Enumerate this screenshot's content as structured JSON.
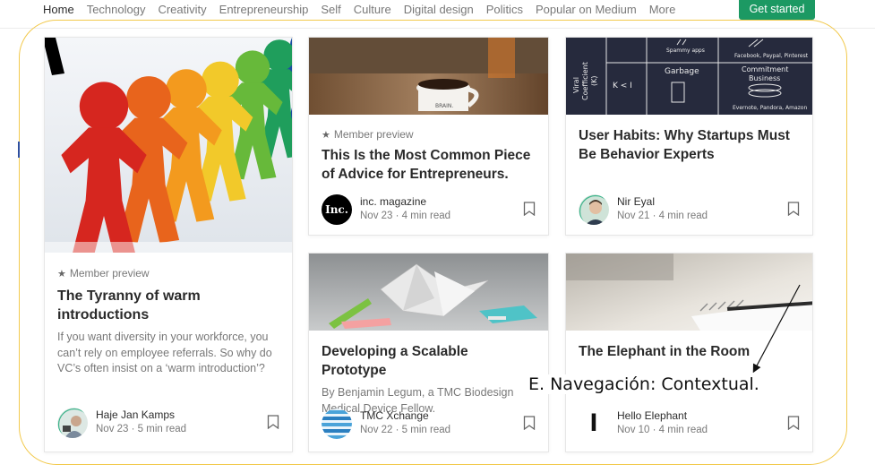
{
  "nav": {
    "items": [
      {
        "label": "Home",
        "active": true
      },
      {
        "label": "Technology"
      },
      {
        "label": "Creativity"
      },
      {
        "label": "Entrepreneurship"
      },
      {
        "label": "Self"
      },
      {
        "label": "Culture"
      },
      {
        "label": "Digital design"
      },
      {
        "label": "Politics"
      },
      {
        "label": "Popular on Medium"
      },
      {
        "label": "More"
      }
    ],
    "cta_label": "Get started",
    "cta_color": "#1c9963"
  },
  "cards": [
    {
      "member_preview": "Member preview",
      "title": "The Tyranny of warm introductions",
      "snippet": "If you want diversity in your workforce, you can’t rely on employee referrals. So why do VC’s often insist on a ‘warm introduction’?",
      "author": "Haje Jan Kamps",
      "date": "Nov 23",
      "read_time": "5 min read"
    },
    {
      "member_preview": "Member preview",
      "title": "This Is the Most Common Piece of Advice for Entrepreneurs.",
      "author": "inc. magazine",
      "date": "Nov 23",
      "read_time": "4 min read",
      "avatar_text": "Inc.",
      "mug_text": "BRAIN."
    },
    {
      "title": "User Habits: Why Startups Must Be Behavior Experts",
      "author": "Nir Eyal",
      "date": "Nov 21",
      "read_time": "4 min read",
      "chalk": {
        "viral": "Viral",
        "coefficient": "Coefficient",
        "k": "(K)",
        "k_less": "K < I",
        "spammy": "Spammy apps",
        "garbage": "Garbage",
        "social": "Facebook, Paypal, Pinterest",
        "commitment": "Commitment",
        "business": "Business",
        "examples": "Evernote, Pandora, Amazon"
      }
    },
    {
      "title": "Developing a Scalable Prototype",
      "snippet": "By Benjamin Legum, a TMC Biodesign Medical Device Fellow.",
      "author": "TMC Xchange",
      "date": "Nov 22",
      "read_time": "5 min read"
    },
    {
      "title": "The Elephant in the Room",
      "author": "Hello Elephant",
      "date": "Nov 10",
      "read_time": "4 min read",
      "avatar_text": "l"
    }
  ],
  "annotation": {
    "text": "E. Navegación: Contextual.",
    "frame_color": "#f2c94c"
  }
}
